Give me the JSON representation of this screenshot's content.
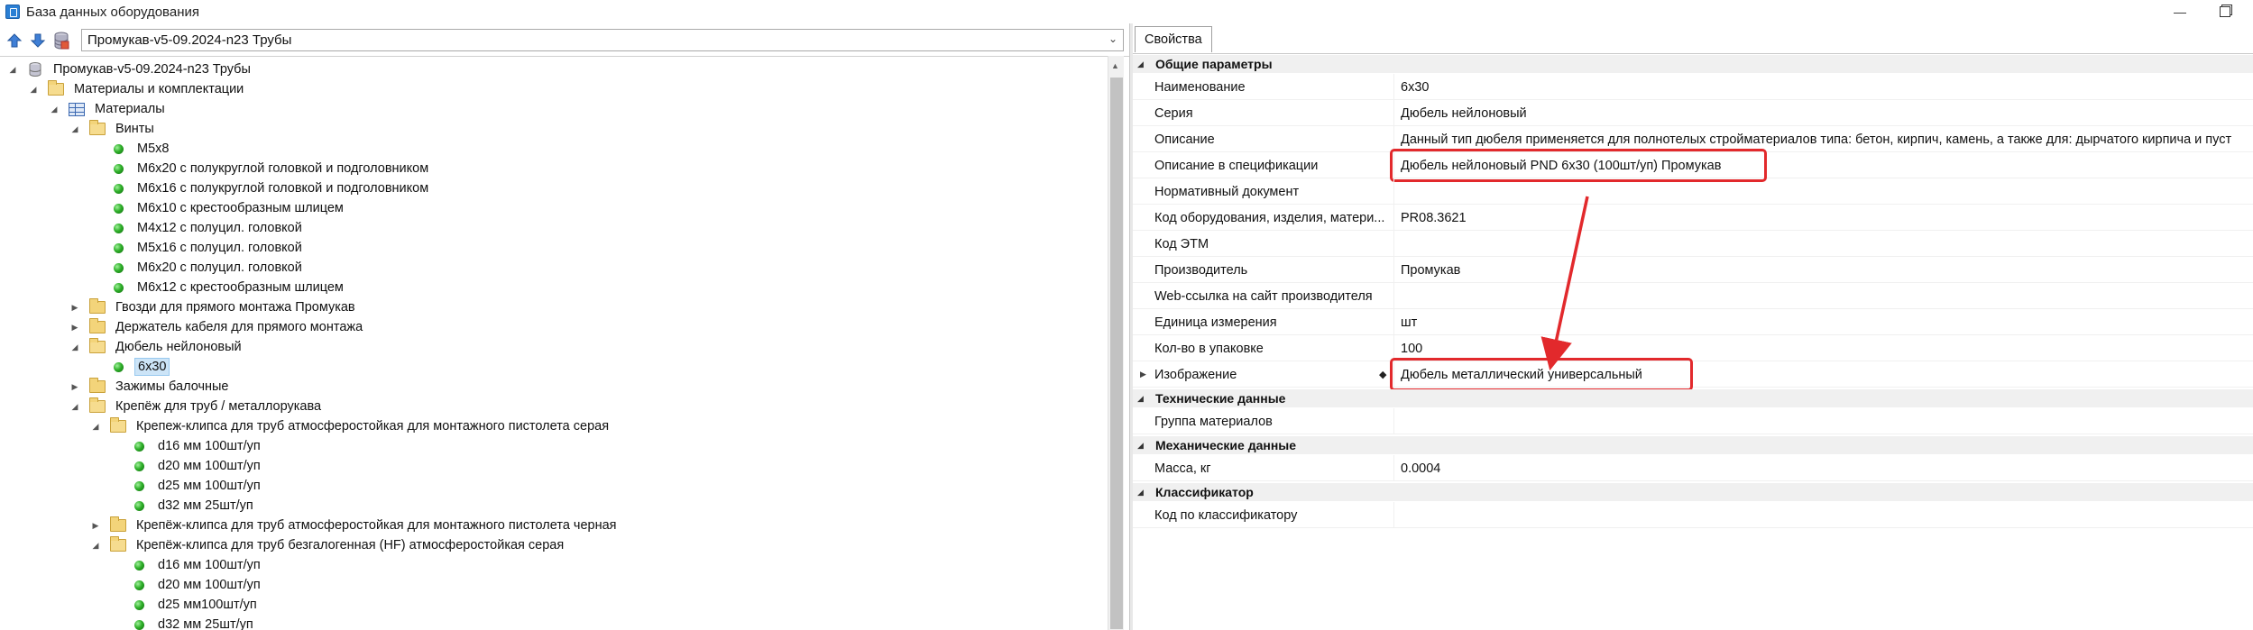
{
  "window": {
    "title": "База данных оборудования",
    "minimize_glyph": "—"
  },
  "toolbar": {
    "database_selected": "Промукав-v5-09.2024-n23 Трубы",
    "buttons": [
      "move-up-icon",
      "move-down-icon",
      "database-icon"
    ]
  },
  "tree": {
    "rows": [
      {
        "label": "Промукав-v5-09.2024-n23 Трубы",
        "icon": "database-icon",
        "expanded": true
      },
      {
        "label": "Материалы и комплектации",
        "icon": "folder-icon",
        "expanded": true
      },
      {
        "label": "Материалы",
        "icon": "table-icon",
        "expanded": true
      },
      {
        "label": "Винты",
        "icon": "folder-icon",
        "expanded": true
      },
      {
        "label": "M5x8",
        "icon": "item-icon"
      },
      {
        "label": "M6x20 с полукруглой головкой и подголовником",
        "icon": "item-icon"
      },
      {
        "label": "M6x16 с полукруглой головкой и подголовником",
        "icon": "item-icon"
      },
      {
        "label": "M6x10 с крестообразным шлицем",
        "icon": "item-icon"
      },
      {
        "label": "M4x12 с полуцил. головкой",
        "icon": "item-icon"
      },
      {
        "label": "M5x16 с полуцил. головкой",
        "icon": "item-icon"
      },
      {
        "label": "M6x20 с полуцил. головкой",
        "icon": "item-icon"
      },
      {
        "label": "M6x12 с крестообразным шлицем",
        "icon": "item-icon"
      },
      {
        "label": "Гвозди для прямого монтажа Промукав",
        "icon": "folder-icon",
        "expanded": false
      },
      {
        "label": "Держатель кабеля для прямого монтажа",
        "icon": "folder-icon",
        "expanded": false
      },
      {
        "label": "Дюбель нейлоновый",
        "icon": "folder-icon",
        "expanded": true
      },
      {
        "label": "6x30",
        "icon": "item-icon",
        "selected": true
      },
      {
        "label": "Зажимы балочные",
        "icon": "folder-icon",
        "expanded": false
      },
      {
        "label": "Крепёж для труб / металлорукава",
        "icon": "folder-icon",
        "expanded": true
      },
      {
        "label": "Крепеж-клипса для труб атмосферостойкая для монтажного пистолета серая",
        "icon": "folder-icon",
        "expanded": true
      },
      {
        "label": "d16 мм 100шт/уп",
        "icon": "item-icon"
      },
      {
        "label": "d20 мм 100шт/уп",
        "icon": "item-icon"
      },
      {
        "label": "d25 мм 100шт/уп",
        "icon": "item-icon"
      },
      {
        "label": "d32 мм 25шт/уп",
        "icon": "item-icon"
      },
      {
        "label": "Крепёж-клипса для труб атмосферостойкая для монтажного пистолета черная",
        "icon": "folder-icon",
        "expanded": false
      },
      {
        "label": "Крепёж-клипса для труб безгалогенная (HF) атмосферостойкая серая",
        "icon": "folder-icon",
        "expanded": true
      },
      {
        "label": "d16 мм 100шт/уп",
        "icon": "item-icon"
      },
      {
        "label": "d20 мм 100шт/уп",
        "icon": "item-icon"
      },
      {
        "label": "d25 мм100шт/уп",
        "icon": "item-icon"
      },
      {
        "label": "d32 мм 25шт/уп",
        "icon": "item-icon"
      }
    ]
  },
  "properties": {
    "tab_label": "Свойства",
    "groups": [
      {
        "title": "Общие параметры",
        "rows": [
          {
            "name": "Наименование",
            "value": "6x30"
          },
          {
            "name": "Серия",
            "value": "Дюбель нейлоновый"
          },
          {
            "name": "Описание",
            "value": "Данный тип дюбеля применяется для полнотелых стройматериалов типа: бетон, кирпич, камень, а также для: дырчатого кирпича и пуст"
          },
          {
            "name": "Описание в спецификации",
            "value": "Дюбель нейлоновый PND 6x30 (100шт/уп) Промукав",
            "highlighted": true
          },
          {
            "name": "Нормативный документ",
            "value": ""
          },
          {
            "name": "Код оборудования, изделия, матери...",
            "value": "PR08.3621"
          },
          {
            "name": "Код ЭТМ",
            "value": ""
          },
          {
            "name": "Производитель",
            "value": "Промукав"
          },
          {
            "name": "Web-ссылка на сайт производителя",
            "value": ""
          },
          {
            "name": "Единица измерения",
            "value": "шт"
          },
          {
            "name": "Кол-во в упаковке",
            "value": "100"
          },
          {
            "name": "Изображение",
            "value": "Дюбель металлический универсальный",
            "highlighted": true,
            "expandable": true,
            "editmark": "◆"
          }
        ]
      },
      {
        "title": "Технические данные",
        "rows": [
          {
            "name": "Группа материалов",
            "value": ""
          }
        ]
      },
      {
        "title": "Механические данные",
        "rows": [
          {
            "name": "Масса, кг",
            "value": "0.0004"
          }
        ]
      },
      {
        "title": "Классификатор",
        "rows": [
          {
            "name": "Код по классификатору",
            "value": ""
          }
        ]
      }
    ]
  },
  "annotation": {
    "color": "#e2292c",
    "type": "arrow from spec description to image field"
  }
}
